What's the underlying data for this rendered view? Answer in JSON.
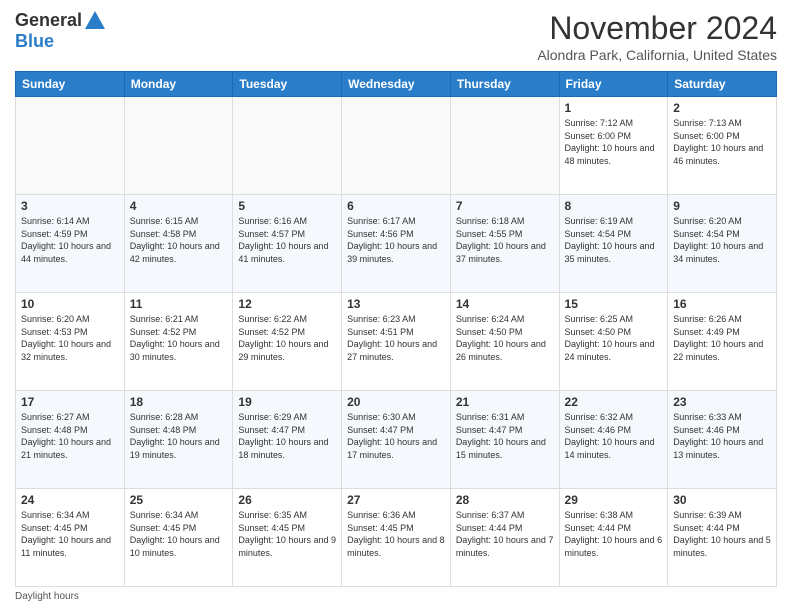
{
  "logo": {
    "general": "General",
    "blue": "Blue"
  },
  "header": {
    "month": "November 2024",
    "location": "Alondra Park, California, United States"
  },
  "days_of_week": [
    "Sunday",
    "Monday",
    "Tuesday",
    "Wednesday",
    "Thursday",
    "Friday",
    "Saturday"
  ],
  "footer": {
    "daylight_label": "Daylight hours"
  },
  "weeks": [
    [
      {
        "day": "",
        "empty": true
      },
      {
        "day": "",
        "empty": true
      },
      {
        "day": "",
        "empty": true
      },
      {
        "day": "",
        "empty": true
      },
      {
        "day": "",
        "empty": true
      },
      {
        "day": "1",
        "sunrise": "Sunrise: 7:12 AM",
        "sunset": "Sunset: 6:00 PM",
        "daylight": "Daylight: 10 hours and 48 minutes."
      },
      {
        "day": "2",
        "sunrise": "Sunrise: 7:13 AM",
        "sunset": "Sunset: 6:00 PM",
        "daylight": "Daylight: 10 hours and 46 minutes."
      }
    ],
    [
      {
        "day": "3",
        "sunrise": "Sunrise: 6:14 AM",
        "sunset": "Sunset: 4:59 PM",
        "daylight": "Daylight: 10 hours and 44 minutes."
      },
      {
        "day": "4",
        "sunrise": "Sunrise: 6:15 AM",
        "sunset": "Sunset: 4:58 PM",
        "daylight": "Daylight: 10 hours and 42 minutes."
      },
      {
        "day": "5",
        "sunrise": "Sunrise: 6:16 AM",
        "sunset": "Sunset: 4:57 PM",
        "daylight": "Daylight: 10 hours and 41 minutes."
      },
      {
        "day": "6",
        "sunrise": "Sunrise: 6:17 AM",
        "sunset": "Sunset: 4:56 PM",
        "daylight": "Daylight: 10 hours and 39 minutes."
      },
      {
        "day": "7",
        "sunrise": "Sunrise: 6:18 AM",
        "sunset": "Sunset: 4:55 PM",
        "daylight": "Daylight: 10 hours and 37 minutes."
      },
      {
        "day": "8",
        "sunrise": "Sunrise: 6:19 AM",
        "sunset": "Sunset: 4:54 PM",
        "daylight": "Daylight: 10 hours and 35 minutes."
      },
      {
        "day": "9",
        "sunrise": "Sunrise: 6:20 AM",
        "sunset": "Sunset: 4:54 PM",
        "daylight": "Daylight: 10 hours and 34 minutes."
      }
    ],
    [
      {
        "day": "10",
        "sunrise": "Sunrise: 6:20 AM",
        "sunset": "Sunset: 4:53 PM",
        "daylight": "Daylight: 10 hours and 32 minutes."
      },
      {
        "day": "11",
        "sunrise": "Sunrise: 6:21 AM",
        "sunset": "Sunset: 4:52 PM",
        "daylight": "Daylight: 10 hours and 30 minutes."
      },
      {
        "day": "12",
        "sunrise": "Sunrise: 6:22 AM",
        "sunset": "Sunset: 4:52 PM",
        "daylight": "Daylight: 10 hours and 29 minutes."
      },
      {
        "day": "13",
        "sunrise": "Sunrise: 6:23 AM",
        "sunset": "Sunset: 4:51 PM",
        "daylight": "Daylight: 10 hours and 27 minutes."
      },
      {
        "day": "14",
        "sunrise": "Sunrise: 6:24 AM",
        "sunset": "Sunset: 4:50 PM",
        "daylight": "Daylight: 10 hours and 26 minutes."
      },
      {
        "day": "15",
        "sunrise": "Sunrise: 6:25 AM",
        "sunset": "Sunset: 4:50 PM",
        "daylight": "Daylight: 10 hours and 24 minutes."
      },
      {
        "day": "16",
        "sunrise": "Sunrise: 6:26 AM",
        "sunset": "Sunset: 4:49 PM",
        "daylight": "Daylight: 10 hours and 22 minutes."
      }
    ],
    [
      {
        "day": "17",
        "sunrise": "Sunrise: 6:27 AM",
        "sunset": "Sunset: 4:48 PM",
        "daylight": "Daylight: 10 hours and 21 minutes."
      },
      {
        "day": "18",
        "sunrise": "Sunrise: 6:28 AM",
        "sunset": "Sunset: 4:48 PM",
        "daylight": "Daylight: 10 hours and 19 minutes."
      },
      {
        "day": "19",
        "sunrise": "Sunrise: 6:29 AM",
        "sunset": "Sunset: 4:47 PM",
        "daylight": "Daylight: 10 hours and 18 minutes."
      },
      {
        "day": "20",
        "sunrise": "Sunrise: 6:30 AM",
        "sunset": "Sunset: 4:47 PM",
        "daylight": "Daylight: 10 hours and 17 minutes."
      },
      {
        "day": "21",
        "sunrise": "Sunrise: 6:31 AM",
        "sunset": "Sunset: 4:47 PM",
        "daylight": "Daylight: 10 hours and 15 minutes."
      },
      {
        "day": "22",
        "sunrise": "Sunrise: 6:32 AM",
        "sunset": "Sunset: 4:46 PM",
        "daylight": "Daylight: 10 hours and 14 minutes."
      },
      {
        "day": "23",
        "sunrise": "Sunrise: 6:33 AM",
        "sunset": "Sunset: 4:46 PM",
        "daylight": "Daylight: 10 hours and 13 minutes."
      }
    ],
    [
      {
        "day": "24",
        "sunrise": "Sunrise: 6:34 AM",
        "sunset": "Sunset: 4:45 PM",
        "daylight": "Daylight: 10 hours and 11 minutes."
      },
      {
        "day": "25",
        "sunrise": "Sunrise: 6:34 AM",
        "sunset": "Sunset: 4:45 PM",
        "daylight": "Daylight: 10 hours and 10 minutes."
      },
      {
        "day": "26",
        "sunrise": "Sunrise: 6:35 AM",
        "sunset": "Sunset: 4:45 PM",
        "daylight": "Daylight: 10 hours and 9 minutes."
      },
      {
        "day": "27",
        "sunrise": "Sunrise: 6:36 AM",
        "sunset": "Sunset: 4:45 PM",
        "daylight": "Daylight: 10 hours and 8 minutes."
      },
      {
        "day": "28",
        "sunrise": "Sunrise: 6:37 AM",
        "sunset": "Sunset: 4:44 PM",
        "daylight": "Daylight: 10 hours and 7 minutes."
      },
      {
        "day": "29",
        "sunrise": "Sunrise: 6:38 AM",
        "sunset": "Sunset: 4:44 PM",
        "daylight": "Daylight: 10 hours and 6 minutes."
      },
      {
        "day": "30",
        "sunrise": "Sunrise: 6:39 AM",
        "sunset": "Sunset: 4:44 PM",
        "daylight": "Daylight: 10 hours and 5 minutes."
      }
    ]
  ]
}
